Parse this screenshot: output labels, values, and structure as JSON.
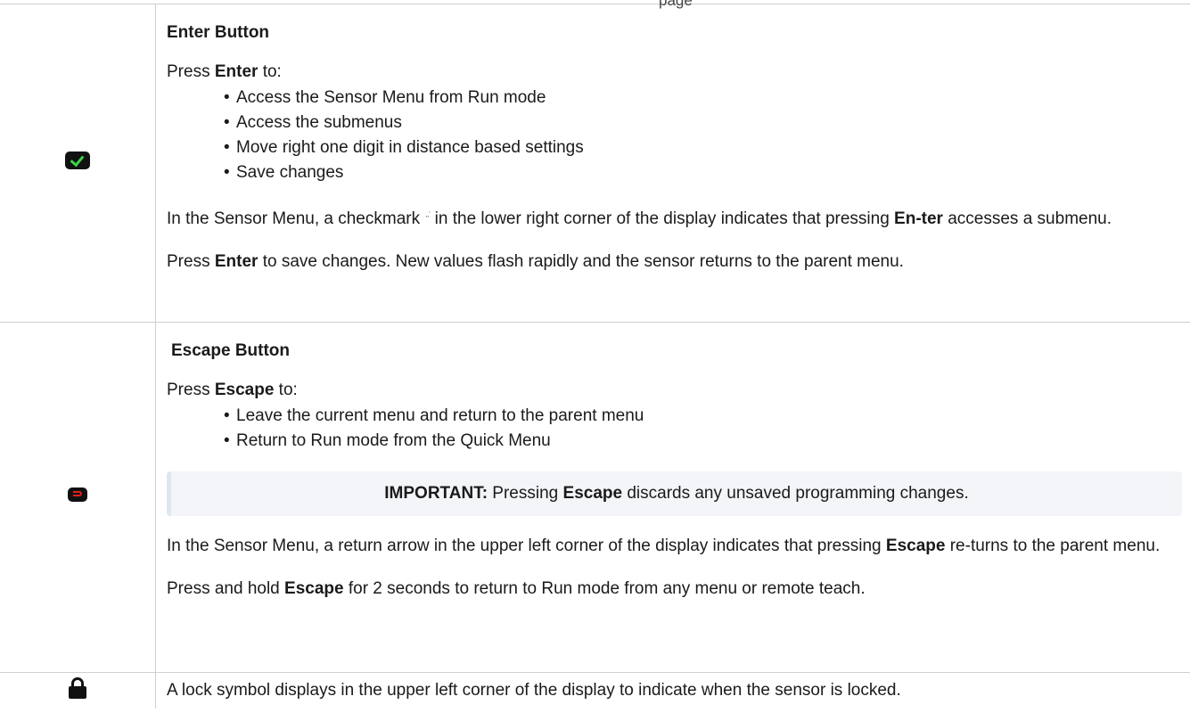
{
  "page_fragment": "page",
  "enter": {
    "heading": "Enter Button",
    "lead_pre": "Press ",
    "lead_key": "Enter",
    "lead_post": " to:",
    "bullets": [
      "Access the Sensor Menu from Run mode",
      "Access the submenus",
      " Move right one digit in distance based settings",
      "Save changes"
    ],
    "para1_pre": "In the Sensor Menu, a checkmark ",
    "para1_icon": "··˙",
    "para1_mid": " in the lower right corner of the display indicates that pressing ",
    "para1_key": "En-ter",
    "para1_post": " accesses a submenu.",
    "para2_pre": "Press ",
    "para2_key": "Enter",
    "para2_post": " to save changes. New values flash rapidly and the sensor returns to the parent menu.",
    "icon": "checkmark-button-icon",
    "icon_color": "#3ad24b"
  },
  "escape": {
    "heading": "Escape Button",
    "lead_pre": "Press ",
    "lead_key": "Escape",
    "lead_post": " to:",
    "bullets": [
      "Leave the current menu and return to the parent menu",
      "Return to Run mode from the Quick Menu"
    ],
    "important_label": "IMPORTANT:",
    "important_pre": " Pressing ",
    "important_key": "Escape",
    "important_post": " discards any unsaved programming changes.",
    "para1_pre": "In the Sensor Menu, a return arrow in the upper left corner of the display indicates that pressing ",
    "para1_key": "Escape",
    "para1_post": " re-turns to the parent menu.",
    "para2_pre": "Press and hold ",
    "para2_key": "Escape",
    "para2_post": " for 2 seconds to return to Run mode from any menu or remote teach.",
    "icon": "return-arrow-button-icon",
    "icon_color": "#e02020"
  },
  "lock": {
    "text": "A lock symbol displays in the upper left corner of the display to indicate when the sensor is locked.",
    "icon": "lock-icon"
  }
}
